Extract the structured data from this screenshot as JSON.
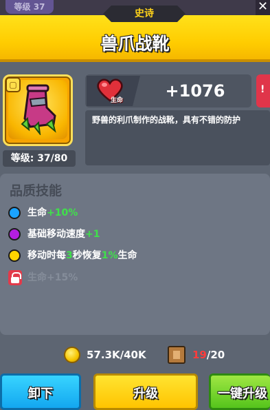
{
  "header": {
    "top_level_text": "等级 37",
    "close_glyph": "✕",
    "rarity_tag": "史诗",
    "item_name": "兽爪战靴"
  },
  "item": {
    "icon": "boot-icon",
    "level_label": "等级: 37/80",
    "stat_label": "生命",
    "stat_value": "+1076",
    "description": "野兽的利爪制作的战靴，具有不错的防护"
  },
  "skills": {
    "title": "品质技能",
    "items": [
      {
        "color": "#1aa3ff",
        "prefix": "生命",
        "highlight": "+10%",
        "suffix": "",
        "mid": "",
        "mid2": "",
        "locked": false
      },
      {
        "color": "#b41ee0",
        "prefix": "基础移动速度",
        "highlight": "+1",
        "suffix": "",
        "mid": "",
        "mid2": "",
        "locked": false
      },
      {
        "color": "#ffd400",
        "prefix": "移动时每",
        "highlight": "3",
        "mid": "秒恢复",
        "mid2": "1%",
        "suffix": "生命",
        "locked": false
      },
      {
        "color": "#e33a4a",
        "prefix": "生命+15%",
        "highlight": "",
        "suffix": "",
        "mid": "",
        "mid2": "",
        "locked": true
      }
    ]
  },
  "resources": {
    "gold": "57.3K/40K",
    "scroll_have": "19",
    "scroll_need": "/20"
  },
  "buttons": {
    "unequip": "卸下",
    "upgrade": "升级",
    "one_key": "一键升级"
  },
  "colors": {
    "banner": "#ffcc00",
    "blue_button": "#13a7f0",
    "yellow_button": "#ffc400",
    "green_button": "#55c41c",
    "green_text": "#3fe24a",
    "red_text": "#ff3b3b"
  }
}
